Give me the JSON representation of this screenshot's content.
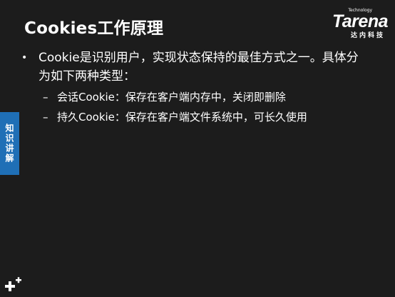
{
  "slide": {
    "title": "Cookies工作原理",
    "logo": {
      "wordmark": "Tarena",
      "tagline": "Technology",
      "chinese": "达内科技"
    },
    "bullets": [
      {
        "text": "Cookie是识别用户，实现状态保持的最佳方式之一。具体分为如下两种类型：",
        "sub_items": [
          "会话Cookie：保存在客户端内存中，关闭即删除",
          "持久Cookie：保存在客户端文件系统中，可长久使用"
        ]
      }
    ],
    "side_tab": "知识讲解",
    "bottom_icon": "plus-icon"
  }
}
